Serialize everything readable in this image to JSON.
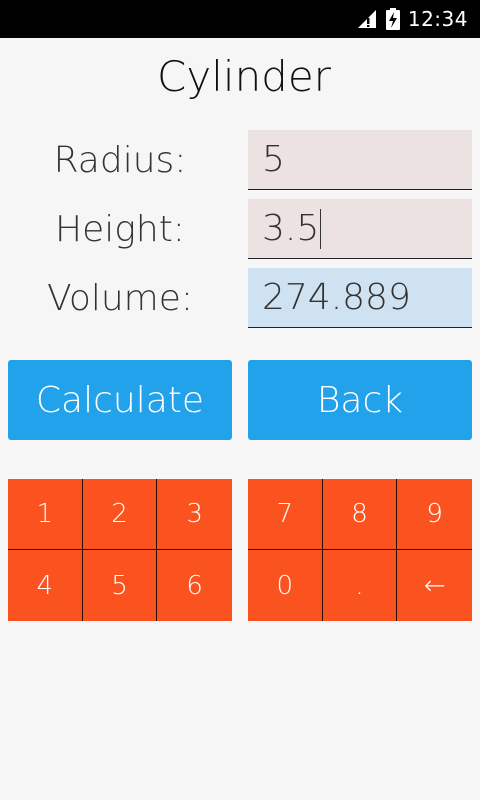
{
  "status_bar": {
    "time": "12:34",
    "icons": [
      "signal-alert-icon",
      "battery-charging-icon"
    ]
  },
  "title": "Cylinder",
  "fields": {
    "radius": {
      "label": "Radius:",
      "value": "5"
    },
    "height": {
      "label": "Height:",
      "value": "3.5"
    },
    "volume": {
      "label": "Volume:",
      "value": "274.889"
    }
  },
  "buttons": {
    "calculate": "Calculate",
    "back": "Back"
  },
  "keypad_left": [
    "1",
    "2",
    "3",
    "4",
    "5",
    "6"
  ],
  "keypad_right": [
    "7",
    "8",
    "9",
    "0",
    ".",
    "←"
  ],
  "colors": {
    "button_blue": "#23a2ec",
    "keypad_orange": "#fb531f",
    "input_bg": "#ece2e2",
    "output_bg": "#cfe2f1"
  }
}
